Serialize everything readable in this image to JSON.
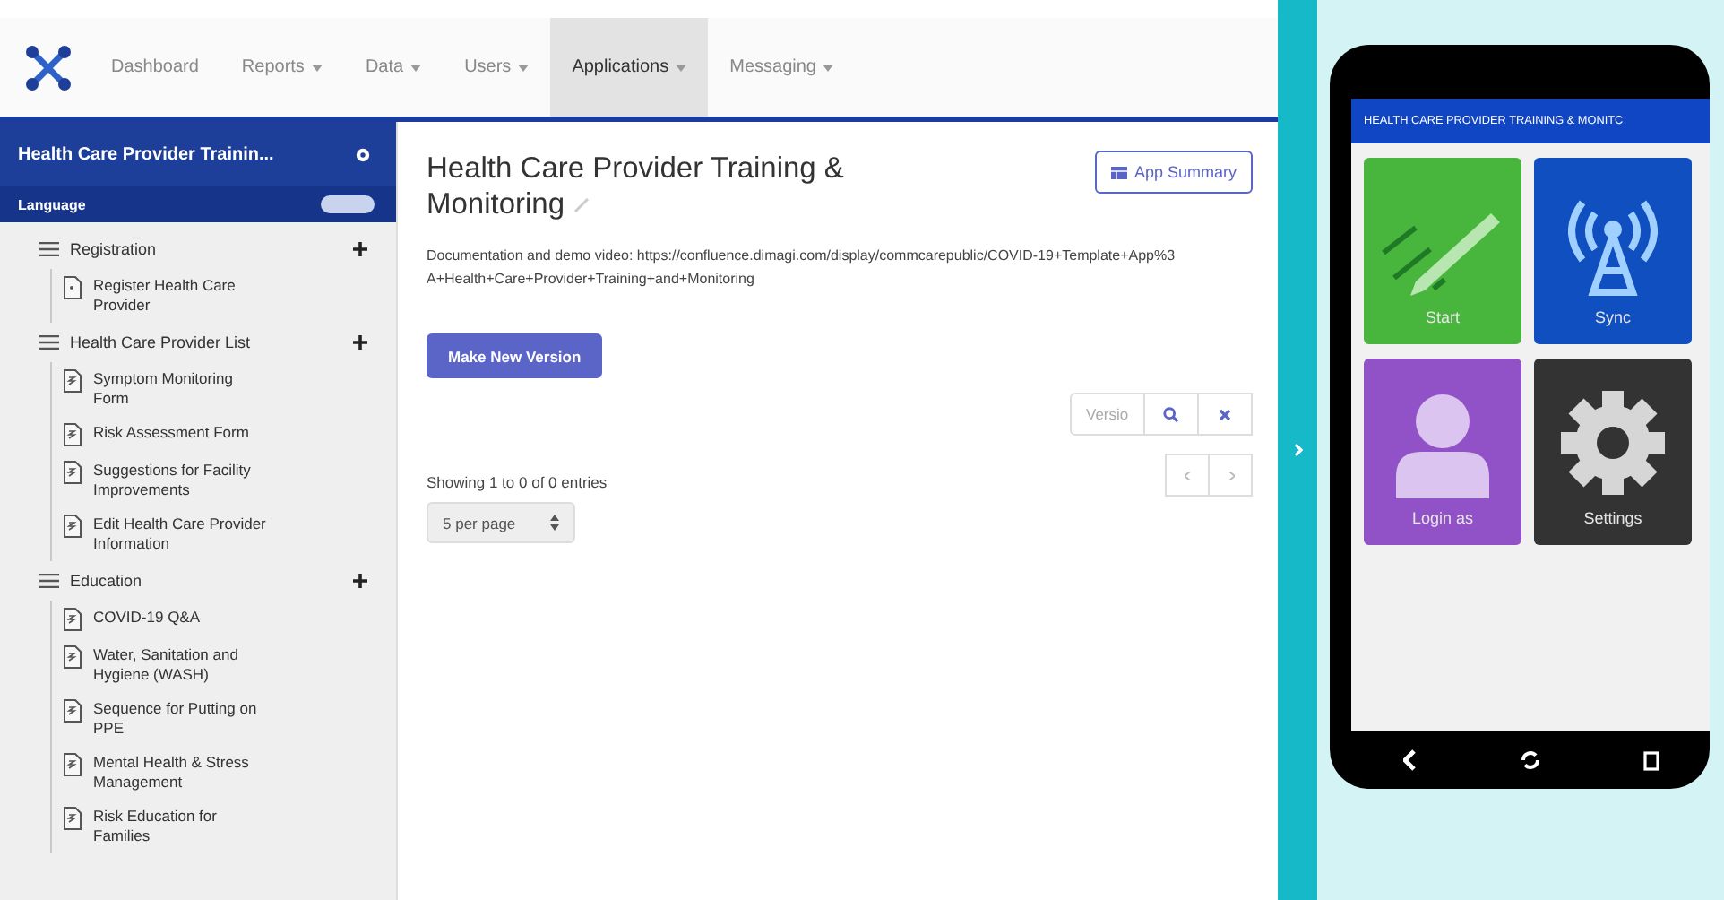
{
  "nav": {
    "items": [
      {
        "label": "Dashboard",
        "dropdown": false,
        "selected": false
      },
      {
        "label": "Reports",
        "dropdown": true,
        "selected": false
      },
      {
        "label": "Data",
        "dropdown": true,
        "selected": false
      },
      {
        "label": "Users",
        "dropdown": true,
        "selected": false
      },
      {
        "label": "Applications",
        "dropdown": true,
        "selected": true
      },
      {
        "label": "Messaging",
        "dropdown": true,
        "selected": false
      }
    ]
  },
  "sidebar": {
    "app_title": "Health Care Provider Trainin...",
    "language_label": "Language",
    "modules": [
      {
        "label": "Registration",
        "children": [
          {
            "label": "Register Health Care Provider",
            "kind": "register"
          }
        ]
      },
      {
        "label": "Health Care Provider List",
        "children": [
          {
            "label": "Symptom Monitoring Form",
            "kind": "form"
          },
          {
            "label": "Risk Assessment Form",
            "kind": "form"
          },
          {
            "label": "Suggestions for Facility Improvements",
            "kind": "form"
          },
          {
            "label": "Edit Health Care Provider Information",
            "kind": "form"
          }
        ]
      },
      {
        "label": "Education",
        "children": [
          {
            "label": "COVID-19 Q&A",
            "kind": "form"
          },
          {
            "label": "Water, Sanitation and Hygiene (WASH)",
            "kind": "form"
          },
          {
            "label": "Sequence for Putting on PPE",
            "kind": "form"
          },
          {
            "label": "Mental Health & Stress Management",
            "kind": "form"
          },
          {
            "label": "Risk Education for Families",
            "kind": "form"
          }
        ]
      }
    ]
  },
  "main": {
    "title": "Health Care Provider Training & Monitoring",
    "app_summary_button": "App Summary",
    "documentation": "Documentation and demo video: https://confluence.dimagi.com/display/commcarepublic/COVID-19+Template+App%3A+Health+Care+Provider+Training+and+Monitoring",
    "make_version_button": "Make New Version",
    "search": {
      "placeholder": "Versio"
    },
    "entries_info": "Showing 1 to 0 of 0 entries",
    "page_size": "5 per page"
  },
  "preview": {
    "header": "HEALTH CARE PROVIDER TRAINING & MONITC",
    "tiles": [
      {
        "label": "Start",
        "kind": "start",
        "color": "#48b53c"
      },
      {
        "label": "Sync",
        "kind": "sync",
        "color": "#0f4fbf"
      },
      {
        "label": "Login as",
        "kind": "login",
        "color": "#9152c8"
      },
      {
        "label": "Settings",
        "kind": "settings",
        "color": "#333333"
      }
    ]
  }
}
